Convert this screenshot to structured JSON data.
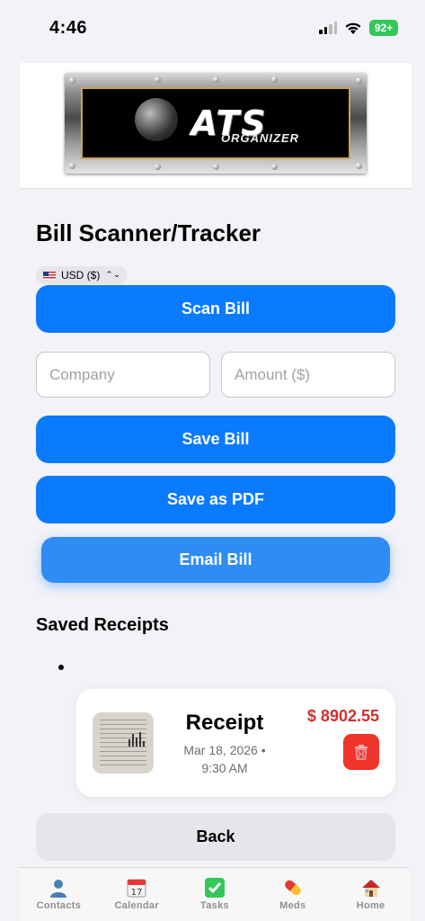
{
  "status_bar": {
    "time": "4:46",
    "battery": "92+"
  },
  "logo": {
    "main_text": "ATS",
    "sub_text": "ORGANIZER"
  },
  "page": {
    "title": "Bill Scanner/Tracker"
  },
  "currency": {
    "selected": "USD ($)"
  },
  "buttons": {
    "scan": "Scan Bill",
    "save": "Save Bill",
    "pdf": "Save as PDF",
    "email": "Email Bill",
    "back": "Back"
  },
  "form": {
    "company_placeholder": "Company",
    "company_value": "",
    "amount_placeholder": "Amount ($)",
    "amount_value": ""
  },
  "receipts": {
    "section_title": "Saved Receipts",
    "items": [
      {
        "title": "Receipt",
        "date": "Mar 18, 2026 •",
        "time": "9:30 AM",
        "amount": "$ 8902.55"
      }
    ]
  },
  "tabs": [
    {
      "label": "Contacts",
      "icon": "contacts-icon"
    },
    {
      "label": "Calendar",
      "icon": "calendar-icon",
      "icon_text": "17"
    },
    {
      "label": "Tasks",
      "icon": "checkmark-icon"
    },
    {
      "label": "Meds",
      "icon": "pill-icon"
    },
    {
      "label": "Home",
      "icon": "home-icon"
    }
  ],
  "colors": {
    "primary": "#0a7aff",
    "danger": "#f0332b",
    "amount": "#d32f2f",
    "background": "#f2f2f7"
  }
}
